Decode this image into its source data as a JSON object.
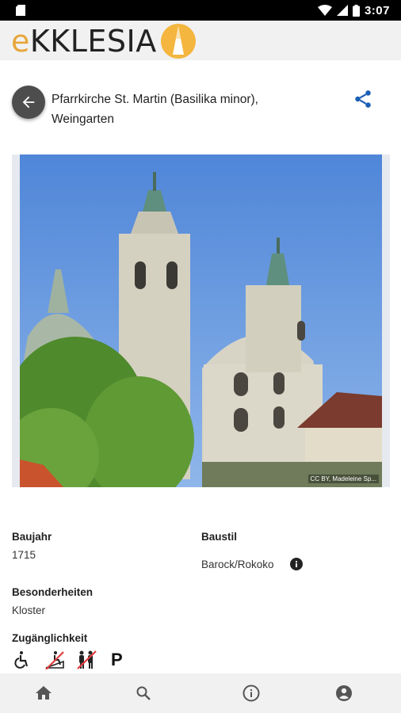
{
  "status_bar": {
    "time": "3:07"
  },
  "app": {
    "logo_prefix": "e",
    "logo_rest": "KKLESIA"
  },
  "church": {
    "name_line1": "Pfarrkirche St. Martin (Basilika minor),",
    "name_line2": "Weingarten"
  },
  "photo": {
    "credit": "CC BY, Madeleine Sp..."
  },
  "details": {
    "baujahr_label": "Baujahr",
    "baujahr_value": "1715",
    "baustil_label": "Baustil",
    "baustil_value": "Barock/Rokoko",
    "besonderheiten_label": "Besonderheiten",
    "besonderheiten_value": "Kloster",
    "zugang_label": "Zugänglichkeit",
    "accessibility": [
      {
        "icon": "wheelchair-icon",
        "available": true
      },
      {
        "icon": "wheelchair-ramp-icon",
        "available": false
      },
      {
        "icon": "family-icon",
        "available": false
      },
      {
        "icon": "parking-icon",
        "available": true,
        "text": "P"
      }
    ]
  },
  "nav": [
    "home-icon",
    "search-icon",
    "info-icon",
    "account-icon"
  ],
  "colors": {
    "accent": "#1a5fb4",
    "logo_gold": "#e7a63a",
    "strike": "#e03b3b"
  }
}
